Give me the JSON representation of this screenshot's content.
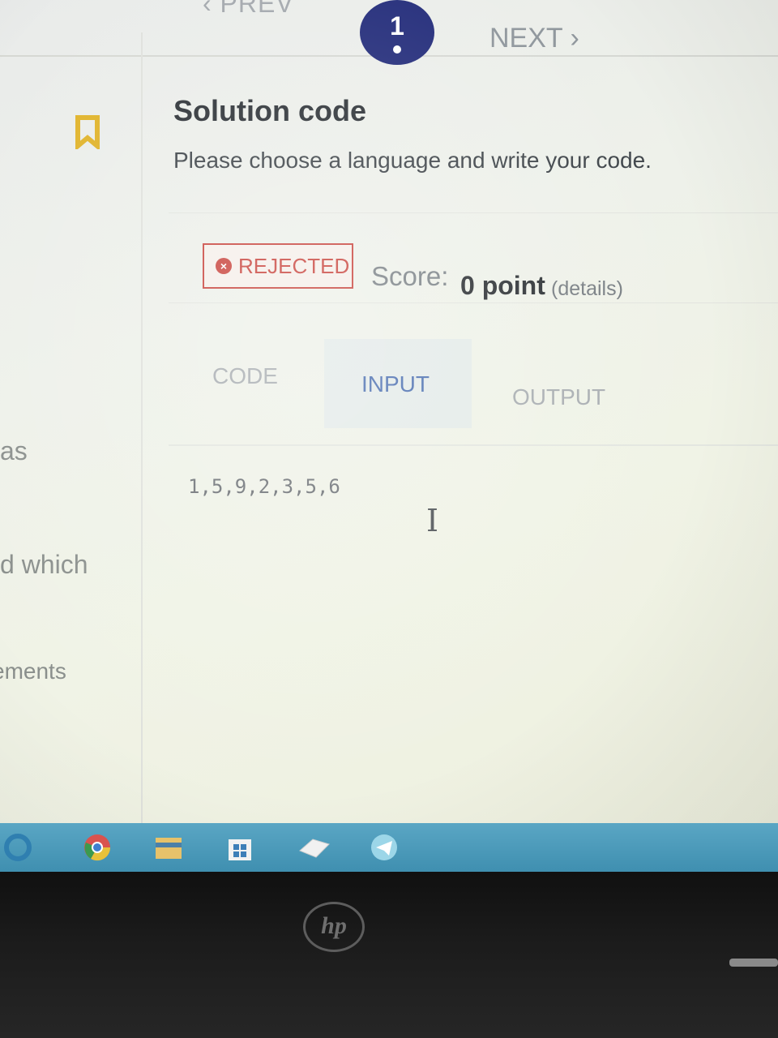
{
  "nav": {
    "prev_label": "‹ PREV",
    "step_number": "1",
    "next_label": "NEXT ›"
  },
  "left_fragments": [
    "as",
    "d which",
    "ements"
  ],
  "main": {
    "title": "Solution code",
    "subtitle": "Please choose a language and write your code.",
    "status_badge": "REJECTED",
    "score_label": "Score:",
    "score_value": "0 point",
    "details_link": "(details)"
  },
  "tabs": [
    {
      "label": "CODE",
      "active": false
    },
    {
      "label": "INPUT",
      "active": true
    },
    {
      "label": "OUTPUT",
      "active": false
    }
  ],
  "input_content": "1,5,9,2,3,5,6",
  "icons": {
    "bookmark": "bookmark-icon",
    "status": "x-circle-icon",
    "cursor": "text-cursor-icon"
  },
  "colors": {
    "step_circle": "#232c7a",
    "bookmark": "#e0b329",
    "rejected": "#c9463f",
    "active_tab": "#4a6eb0",
    "taskbar": "#4b9abb"
  },
  "taskbar_icons": [
    "edge-icon",
    "chrome-icon",
    "file-explorer-icon",
    "store-icon",
    "eraser-icon",
    "telegram-icon"
  ],
  "bezel_logo": "hp"
}
